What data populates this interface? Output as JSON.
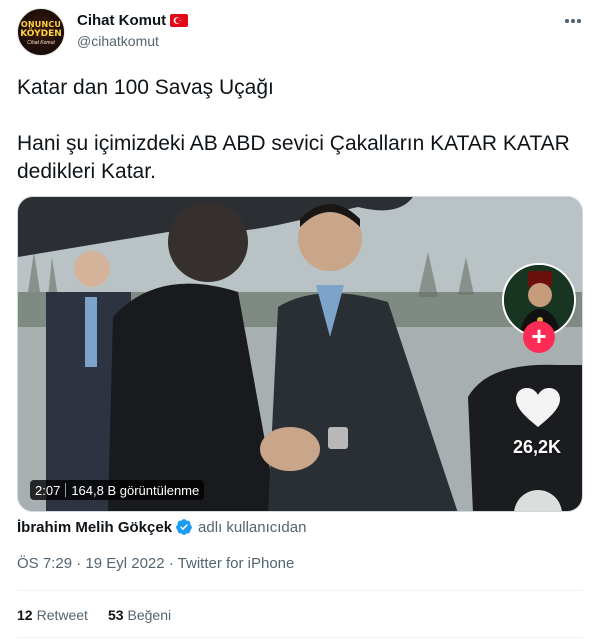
{
  "author": {
    "display_name": "Cihat Komut",
    "handle": "@cihatkomut",
    "avatar_text_line1": "ONUNCU",
    "avatar_text_line2": "KÖYDEN",
    "avatar_text_line3": "Cihat Komut",
    "flag_icon": "turkey-flag-icon"
  },
  "tweet": {
    "text": "Katar dan 100 Savaş Uçağı\n\nHani şu içimizdeki AB ABD sevici Çakalların KATAR KATAR dedikleri Katar."
  },
  "media": {
    "duration": "2:07",
    "views": "164,8 B görüntülenme",
    "like_count": "26,2K",
    "plus_symbol": "+",
    "accent_color": "#fe2c55"
  },
  "attribution": {
    "name": "İbrahim Melih Gökçek",
    "suffix": "adlı kullanıcıdan",
    "verified_color": "#1d9bf0"
  },
  "meta": {
    "timestamp": "ÖS 7:29 · 19 Eyl 2022 · Twitter for iPhone"
  },
  "stats": {
    "retweets_count": "12",
    "retweets_label": "Retweet",
    "likes_count": "53",
    "likes_label": "Beğeni"
  }
}
